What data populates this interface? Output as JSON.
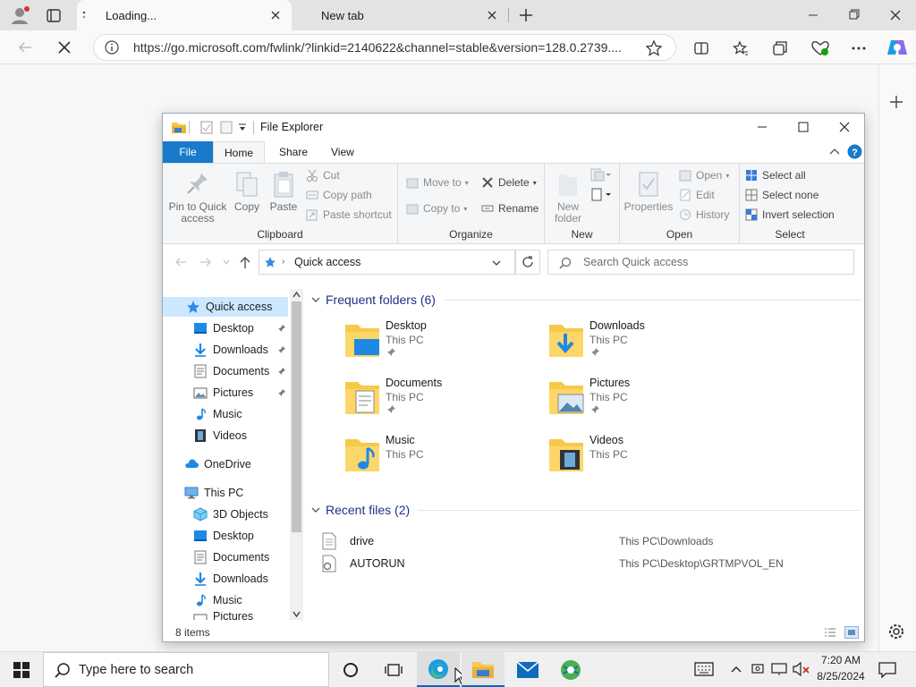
{
  "browser": {
    "tabs": [
      {
        "label": "Loading...",
        "active": true
      },
      {
        "label": "New tab",
        "active": false
      }
    ],
    "url": "https://go.microsoft.com/fwlink/?linkid=2140622&channel=stable&version=128.0.2739....",
    "accent": "#0067c0"
  },
  "explorer": {
    "title": "File Explorer",
    "ribbon_tabs": [
      "File",
      "Home",
      "Share",
      "View"
    ],
    "clipboard": {
      "pin_label_1": "Pin to Quick",
      "pin_label_2": "access",
      "copy": "Copy",
      "paste": "Paste",
      "cut": "Cut",
      "copy_path": "Copy path",
      "paste_shortcut": "Paste shortcut",
      "group": "Clipboard"
    },
    "organize": {
      "move_to": "Move to",
      "copy_to": "Copy to",
      "delete": "Delete",
      "rename": "Rename",
      "group": "Organize"
    },
    "new": {
      "new_folder_1": "New",
      "new_folder_2": "folder",
      "group": "New"
    },
    "open": {
      "properties": "Properties",
      "open": "Open",
      "edit": "Edit",
      "history": "History",
      "group": "Open"
    },
    "select": {
      "select_all": "Select all",
      "select_none": "Select none",
      "invert": "Invert selection",
      "group": "Select"
    },
    "address": "Quick access",
    "search_placeholder": "Search Quick access",
    "nav": {
      "quick_access": "Quick access",
      "qa_items": [
        "Desktop",
        "Downloads",
        "Documents",
        "Pictures",
        "Music",
        "Videos"
      ],
      "onedrive": "OneDrive",
      "this_pc": "This PC",
      "pc_items": [
        "3D Objects",
        "Desktop",
        "Documents",
        "Downloads",
        "Music",
        "Pictures"
      ]
    },
    "frequent_header": "Frequent folders (6)",
    "folders": [
      {
        "name": "Desktop",
        "location": "This PC"
      },
      {
        "name": "Downloads",
        "location": "This PC"
      },
      {
        "name": "Documents",
        "location": "This PC"
      },
      {
        "name": "Pictures",
        "location": "This PC"
      },
      {
        "name": "Music",
        "location": "This PC"
      },
      {
        "name": "Videos",
        "location": "This PC"
      }
    ],
    "recent_header": "Recent files (2)",
    "recent": [
      {
        "name": "drive",
        "path": "This PC\\Downloads"
      },
      {
        "name": "AUTORUN",
        "path": "This PC\\Desktop\\GRTMPVOL_EN"
      }
    ],
    "status": "8 items"
  },
  "taskbar": {
    "search_placeholder": "Type here to search",
    "time": "7:20 AM",
    "date": "8/25/2024"
  }
}
